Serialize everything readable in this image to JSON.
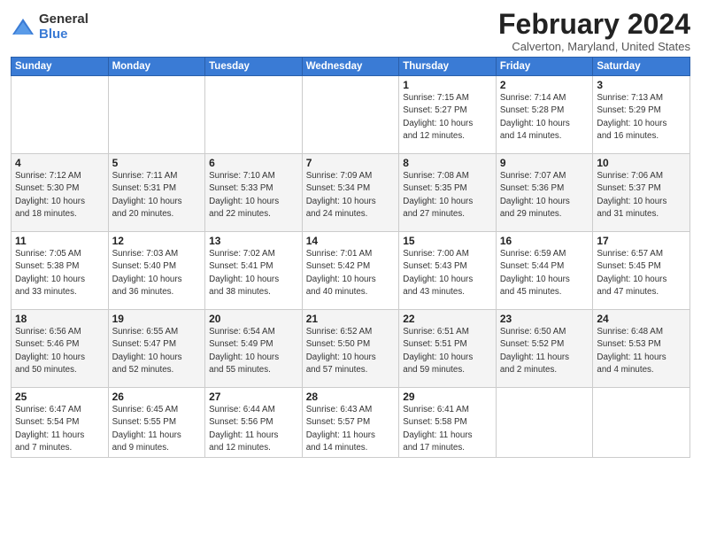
{
  "logo": {
    "general": "General",
    "blue": "Blue",
    "icon_color": "#3a7bd5"
  },
  "header": {
    "month_year": "February 2024",
    "location": "Calverton, Maryland, United States"
  },
  "days_of_week": [
    "Sunday",
    "Monday",
    "Tuesday",
    "Wednesday",
    "Thursday",
    "Friday",
    "Saturday"
  ],
  "weeks": [
    [
      {
        "date": "",
        "info": ""
      },
      {
        "date": "",
        "info": ""
      },
      {
        "date": "",
        "info": ""
      },
      {
        "date": "",
        "info": ""
      },
      {
        "date": "1",
        "info": "Sunrise: 7:15 AM\nSunset: 5:27 PM\nDaylight: 10 hours\nand 12 minutes."
      },
      {
        "date": "2",
        "info": "Sunrise: 7:14 AM\nSunset: 5:28 PM\nDaylight: 10 hours\nand 14 minutes."
      },
      {
        "date": "3",
        "info": "Sunrise: 7:13 AM\nSunset: 5:29 PM\nDaylight: 10 hours\nand 16 minutes."
      }
    ],
    [
      {
        "date": "4",
        "info": "Sunrise: 7:12 AM\nSunset: 5:30 PM\nDaylight: 10 hours\nand 18 minutes."
      },
      {
        "date": "5",
        "info": "Sunrise: 7:11 AM\nSunset: 5:31 PM\nDaylight: 10 hours\nand 20 minutes."
      },
      {
        "date": "6",
        "info": "Sunrise: 7:10 AM\nSunset: 5:33 PM\nDaylight: 10 hours\nand 22 minutes."
      },
      {
        "date": "7",
        "info": "Sunrise: 7:09 AM\nSunset: 5:34 PM\nDaylight: 10 hours\nand 24 minutes."
      },
      {
        "date": "8",
        "info": "Sunrise: 7:08 AM\nSunset: 5:35 PM\nDaylight: 10 hours\nand 27 minutes."
      },
      {
        "date": "9",
        "info": "Sunrise: 7:07 AM\nSunset: 5:36 PM\nDaylight: 10 hours\nand 29 minutes."
      },
      {
        "date": "10",
        "info": "Sunrise: 7:06 AM\nSunset: 5:37 PM\nDaylight: 10 hours\nand 31 minutes."
      }
    ],
    [
      {
        "date": "11",
        "info": "Sunrise: 7:05 AM\nSunset: 5:38 PM\nDaylight: 10 hours\nand 33 minutes."
      },
      {
        "date": "12",
        "info": "Sunrise: 7:03 AM\nSunset: 5:40 PM\nDaylight: 10 hours\nand 36 minutes."
      },
      {
        "date": "13",
        "info": "Sunrise: 7:02 AM\nSunset: 5:41 PM\nDaylight: 10 hours\nand 38 minutes."
      },
      {
        "date": "14",
        "info": "Sunrise: 7:01 AM\nSunset: 5:42 PM\nDaylight: 10 hours\nand 40 minutes."
      },
      {
        "date": "15",
        "info": "Sunrise: 7:00 AM\nSunset: 5:43 PM\nDaylight: 10 hours\nand 43 minutes."
      },
      {
        "date": "16",
        "info": "Sunrise: 6:59 AM\nSunset: 5:44 PM\nDaylight: 10 hours\nand 45 minutes."
      },
      {
        "date": "17",
        "info": "Sunrise: 6:57 AM\nSunset: 5:45 PM\nDaylight: 10 hours\nand 47 minutes."
      }
    ],
    [
      {
        "date": "18",
        "info": "Sunrise: 6:56 AM\nSunset: 5:46 PM\nDaylight: 10 hours\nand 50 minutes."
      },
      {
        "date": "19",
        "info": "Sunrise: 6:55 AM\nSunset: 5:47 PM\nDaylight: 10 hours\nand 52 minutes."
      },
      {
        "date": "20",
        "info": "Sunrise: 6:54 AM\nSunset: 5:49 PM\nDaylight: 10 hours\nand 55 minutes."
      },
      {
        "date": "21",
        "info": "Sunrise: 6:52 AM\nSunset: 5:50 PM\nDaylight: 10 hours\nand 57 minutes."
      },
      {
        "date": "22",
        "info": "Sunrise: 6:51 AM\nSunset: 5:51 PM\nDaylight: 10 hours\nand 59 minutes."
      },
      {
        "date": "23",
        "info": "Sunrise: 6:50 AM\nSunset: 5:52 PM\nDaylight: 11 hours\nand 2 minutes."
      },
      {
        "date": "24",
        "info": "Sunrise: 6:48 AM\nSunset: 5:53 PM\nDaylight: 11 hours\nand 4 minutes."
      }
    ],
    [
      {
        "date": "25",
        "info": "Sunrise: 6:47 AM\nSunset: 5:54 PM\nDaylight: 11 hours\nand 7 minutes."
      },
      {
        "date": "26",
        "info": "Sunrise: 6:45 AM\nSunset: 5:55 PM\nDaylight: 11 hours\nand 9 minutes."
      },
      {
        "date": "27",
        "info": "Sunrise: 6:44 AM\nSunset: 5:56 PM\nDaylight: 11 hours\nand 12 minutes."
      },
      {
        "date": "28",
        "info": "Sunrise: 6:43 AM\nSunset: 5:57 PM\nDaylight: 11 hours\nand 14 minutes."
      },
      {
        "date": "29",
        "info": "Sunrise: 6:41 AM\nSunset: 5:58 PM\nDaylight: 11 hours\nand 17 minutes."
      },
      {
        "date": "",
        "info": ""
      },
      {
        "date": "",
        "info": ""
      }
    ]
  ]
}
